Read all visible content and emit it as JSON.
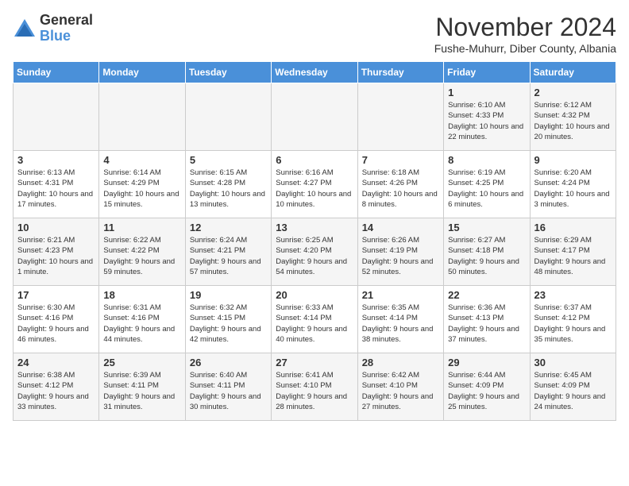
{
  "logo": {
    "general": "General",
    "blue": "Blue"
  },
  "title": {
    "month_year": "November 2024",
    "location": "Fushe-Muhurr, Diber County, Albania"
  },
  "headers": [
    "Sunday",
    "Monday",
    "Tuesday",
    "Wednesday",
    "Thursday",
    "Friday",
    "Saturday"
  ],
  "weeks": [
    [
      {
        "day": "",
        "info": ""
      },
      {
        "day": "",
        "info": ""
      },
      {
        "day": "",
        "info": ""
      },
      {
        "day": "",
        "info": ""
      },
      {
        "day": "",
        "info": ""
      },
      {
        "day": "1",
        "info": "Sunrise: 6:10 AM\nSunset: 4:33 PM\nDaylight: 10 hours and 22 minutes."
      },
      {
        "day": "2",
        "info": "Sunrise: 6:12 AM\nSunset: 4:32 PM\nDaylight: 10 hours and 20 minutes."
      }
    ],
    [
      {
        "day": "3",
        "info": "Sunrise: 6:13 AM\nSunset: 4:31 PM\nDaylight: 10 hours and 17 minutes."
      },
      {
        "day": "4",
        "info": "Sunrise: 6:14 AM\nSunset: 4:29 PM\nDaylight: 10 hours and 15 minutes."
      },
      {
        "day": "5",
        "info": "Sunrise: 6:15 AM\nSunset: 4:28 PM\nDaylight: 10 hours and 13 minutes."
      },
      {
        "day": "6",
        "info": "Sunrise: 6:16 AM\nSunset: 4:27 PM\nDaylight: 10 hours and 10 minutes."
      },
      {
        "day": "7",
        "info": "Sunrise: 6:18 AM\nSunset: 4:26 PM\nDaylight: 10 hours and 8 minutes."
      },
      {
        "day": "8",
        "info": "Sunrise: 6:19 AM\nSunset: 4:25 PM\nDaylight: 10 hours and 6 minutes."
      },
      {
        "day": "9",
        "info": "Sunrise: 6:20 AM\nSunset: 4:24 PM\nDaylight: 10 hours and 3 minutes."
      }
    ],
    [
      {
        "day": "10",
        "info": "Sunrise: 6:21 AM\nSunset: 4:23 PM\nDaylight: 10 hours and 1 minute."
      },
      {
        "day": "11",
        "info": "Sunrise: 6:22 AM\nSunset: 4:22 PM\nDaylight: 9 hours and 59 minutes."
      },
      {
        "day": "12",
        "info": "Sunrise: 6:24 AM\nSunset: 4:21 PM\nDaylight: 9 hours and 57 minutes."
      },
      {
        "day": "13",
        "info": "Sunrise: 6:25 AM\nSunset: 4:20 PM\nDaylight: 9 hours and 54 minutes."
      },
      {
        "day": "14",
        "info": "Sunrise: 6:26 AM\nSunset: 4:19 PM\nDaylight: 9 hours and 52 minutes."
      },
      {
        "day": "15",
        "info": "Sunrise: 6:27 AM\nSunset: 4:18 PM\nDaylight: 9 hours and 50 minutes."
      },
      {
        "day": "16",
        "info": "Sunrise: 6:29 AM\nSunset: 4:17 PM\nDaylight: 9 hours and 48 minutes."
      }
    ],
    [
      {
        "day": "17",
        "info": "Sunrise: 6:30 AM\nSunset: 4:16 PM\nDaylight: 9 hours and 46 minutes."
      },
      {
        "day": "18",
        "info": "Sunrise: 6:31 AM\nSunset: 4:16 PM\nDaylight: 9 hours and 44 minutes."
      },
      {
        "day": "19",
        "info": "Sunrise: 6:32 AM\nSunset: 4:15 PM\nDaylight: 9 hours and 42 minutes."
      },
      {
        "day": "20",
        "info": "Sunrise: 6:33 AM\nSunset: 4:14 PM\nDaylight: 9 hours and 40 minutes."
      },
      {
        "day": "21",
        "info": "Sunrise: 6:35 AM\nSunset: 4:14 PM\nDaylight: 9 hours and 38 minutes."
      },
      {
        "day": "22",
        "info": "Sunrise: 6:36 AM\nSunset: 4:13 PM\nDaylight: 9 hours and 37 minutes."
      },
      {
        "day": "23",
        "info": "Sunrise: 6:37 AM\nSunset: 4:12 PM\nDaylight: 9 hours and 35 minutes."
      }
    ],
    [
      {
        "day": "24",
        "info": "Sunrise: 6:38 AM\nSunset: 4:12 PM\nDaylight: 9 hours and 33 minutes."
      },
      {
        "day": "25",
        "info": "Sunrise: 6:39 AM\nSunset: 4:11 PM\nDaylight: 9 hours and 31 minutes."
      },
      {
        "day": "26",
        "info": "Sunrise: 6:40 AM\nSunset: 4:11 PM\nDaylight: 9 hours and 30 minutes."
      },
      {
        "day": "27",
        "info": "Sunrise: 6:41 AM\nSunset: 4:10 PM\nDaylight: 9 hours and 28 minutes."
      },
      {
        "day": "28",
        "info": "Sunrise: 6:42 AM\nSunset: 4:10 PM\nDaylight: 9 hours and 27 minutes."
      },
      {
        "day": "29",
        "info": "Sunrise: 6:44 AM\nSunset: 4:09 PM\nDaylight: 9 hours and 25 minutes."
      },
      {
        "day": "30",
        "info": "Sunrise: 6:45 AM\nSunset: 4:09 PM\nDaylight: 9 hours and 24 minutes."
      }
    ]
  ]
}
